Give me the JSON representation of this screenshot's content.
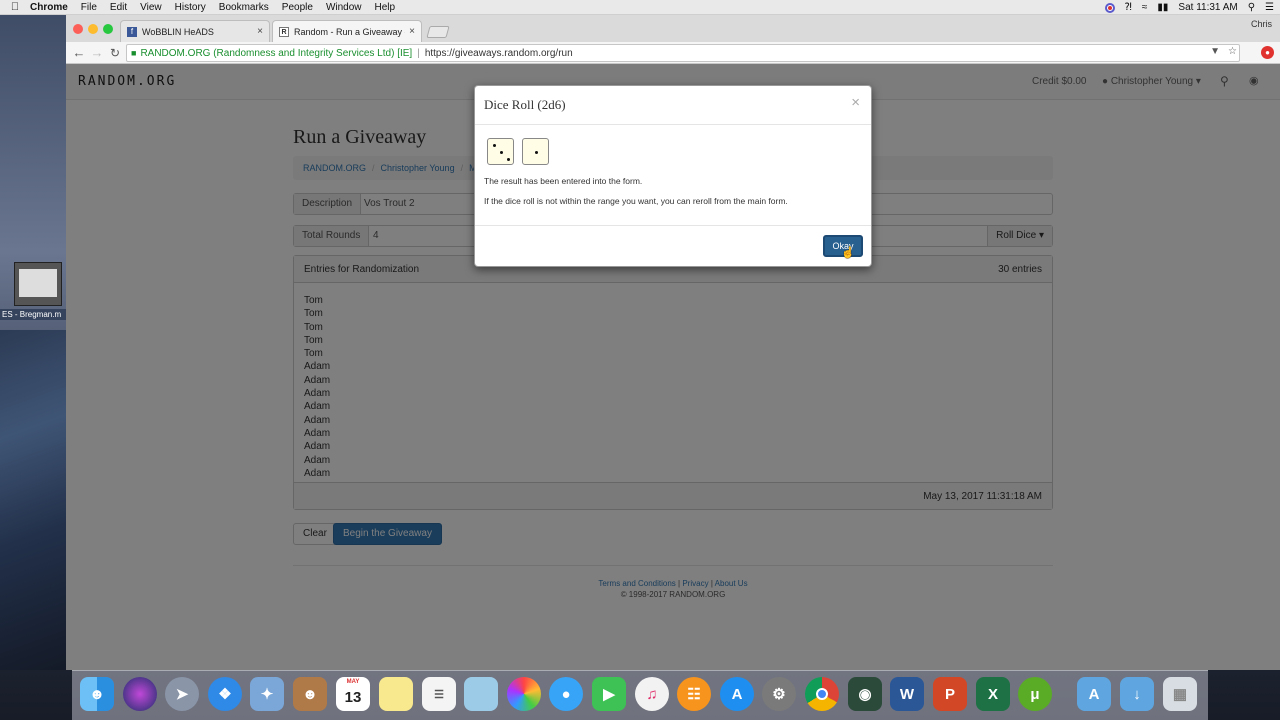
{
  "menubar": {
    "app": "Chrome",
    "items": [
      "File",
      "Edit",
      "View",
      "History",
      "Bookmarks",
      "People",
      "Window",
      "Help"
    ],
    "clock": "Sat 11:31 AM",
    "user": "Chris"
  },
  "desktop": {
    "item_label": "ES - Bregman.m"
  },
  "browser": {
    "tabs": [
      {
        "title": "WoBBLIN HeADS"
      },
      {
        "title": "Random - Run a Giveaway - RANDOM.ORG"
      }
    ],
    "ev_org": "RANDOM.ORG (Randomness and Integrity Services Ltd) [IE]",
    "url": "https://giveaways.random.org/run"
  },
  "site": {
    "logo": "RANDOM.ORG",
    "credit": "Credit $0.00",
    "user": "Christopher Young"
  },
  "page": {
    "title": "Run a Giveaway",
    "breadcrumbs": [
      "RANDOM.ORG",
      "Christopher Young",
      "Multi-"
    ],
    "description_label": "Description",
    "description_value": "Vos Trout 2",
    "rounds_label": "Total Rounds",
    "rounds_value": "4",
    "roll_dice": "Roll Dice",
    "entries_label": "Entries for Randomization",
    "entries_count": "30 entries",
    "entries": [
      "Tom",
      "Tom",
      "Tom",
      "Tom",
      "Tom",
      "Adam",
      "Adam",
      "Adam",
      "Adam",
      "Adam",
      "Adam",
      "Adam",
      "Adam",
      "Adam"
    ],
    "timestamp": "May 13, 2017 11:31:18 AM",
    "clear_btn": "Clear",
    "begin_btn": "Begin the Giveaway",
    "footer_links": [
      "Terms and Conditions",
      "Privacy",
      "About Us"
    ],
    "copyright": "© 1998-2017 RANDOM.ORG"
  },
  "modal": {
    "title": "Dice Roll (2d6)",
    "dice_values": [
      3,
      1
    ],
    "line1": "The result has been entered into the form.",
    "line2": "If the dice roll is not within the range you want, you can reroll from the main form.",
    "ok_label": "Okay"
  },
  "dock": {
    "apps": [
      "Finder",
      "Siri",
      "Launchpad",
      "Safari",
      "Mail",
      "Contacts",
      "Calendar",
      "Notes",
      "Reminders",
      "Preview",
      "Photos",
      "Messages",
      "FaceTime",
      "iTunes",
      "iBooks",
      "App Store",
      "System Preferences",
      "Chrome",
      "Video",
      "Word",
      "PowerPoint",
      "Excel",
      "uTorrent",
      "Applications",
      "Downloads",
      "Trash"
    ],
    "calendar_month": "MAY",
    "calendar_day": "13"
  }
}
